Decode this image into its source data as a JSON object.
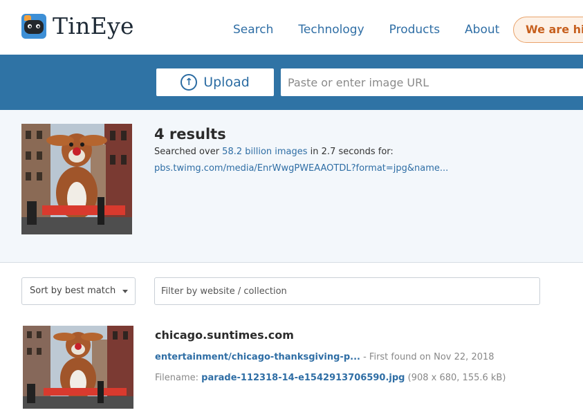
{
  "header": {
    "logo_text": "TinEye",
    "nav": [
      "Search",
      "Technology",
      "Products",
      "About"
    ],
    "hiring_label": "We are hiring"
  },
  "search_bar": {
    "upload_label": "Upload",
    "url_placeholder": "Paste or enter image URL"
  },
  "summary": {
    "results_count": "4 results",
    "searched_prefix": "Searched over ",
    "searched_count": "58.2 billion images",
    "searched_suffix": " in 2.7 seconds for:",
    "query_url": "pbs.twimg.com/media/EnrWwgPWEAAOTDL?format=jpg&name..."
  },
  "controls": {
    "sort_label": "Sort by best match",
    "filter_placeholder": "Filter by website / collection"
  },
  "results": [
    {
      "domain": "chicago.suntimes.com",
      "page_link": "entertainment/chicago-thanksgiving-p...",
      "first_found": " - First found on Nov 22, 2018",
      "filename_label": "Filename: ",
      "filename": "parade-112318-14-e1542913706590.jpg",
      "file_info": " (908 x 680, 155.6 kB)"
    }
  ],
  "colors": {
    "band": "#2f73a5",
    "link": "#2f6ea5",
    "hiring_text": "#c7601e"
  }
}
